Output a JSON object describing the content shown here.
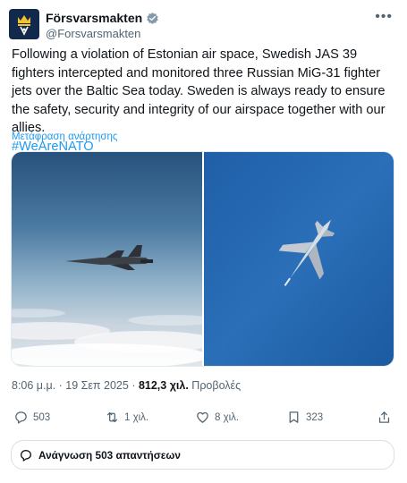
{
  "account": {
    "name": "Försvarsmakten",
    "handle": "@Forsvarsmakten"
  },
  "post": {
    "text": "Following a violation of Estonian air space, Swedish JAS 39 fighters intercepted and monitored three Russian MiG-31 fighter jets over the Baltic Sea today. Sweden is always ready to ensure the safety, security and integrity of our airspace together with our allies.",
    "hashtag": "#WeAreNATO",
    "translate_label": "Μετάφραση ανάρτησης"
  },
  "meta": {
    "timestamp": "8:06 μ.μ. · 19 Σεπ 2025 · ",
    "views_count": "812,3 χιλ.",
    "views_label": " Προβολές"
  },
  "actions": {
    "replies": "503",
    "reposts": "1 χιλ.",
    "likes": "8 χιλ.",
    "bookmarks": "323"
  },
  "read_replies_label": "Ανάγνωση 503 απαντήσεων",
  "icons": [
    "verified-badge-icon",
    "more-icon",
    "reply-icon",
    "repost-icon",
    "like-icon",
    "bookmark-icon",
    "share-icon",
    "speech-bubble-icon"
  ],
  "colors": {
    "accent": "#1d9bf0",
    "text": "#0f1419",
    "muted": "#536471",
    "avatar_bg": "#13294b"
  }
}
